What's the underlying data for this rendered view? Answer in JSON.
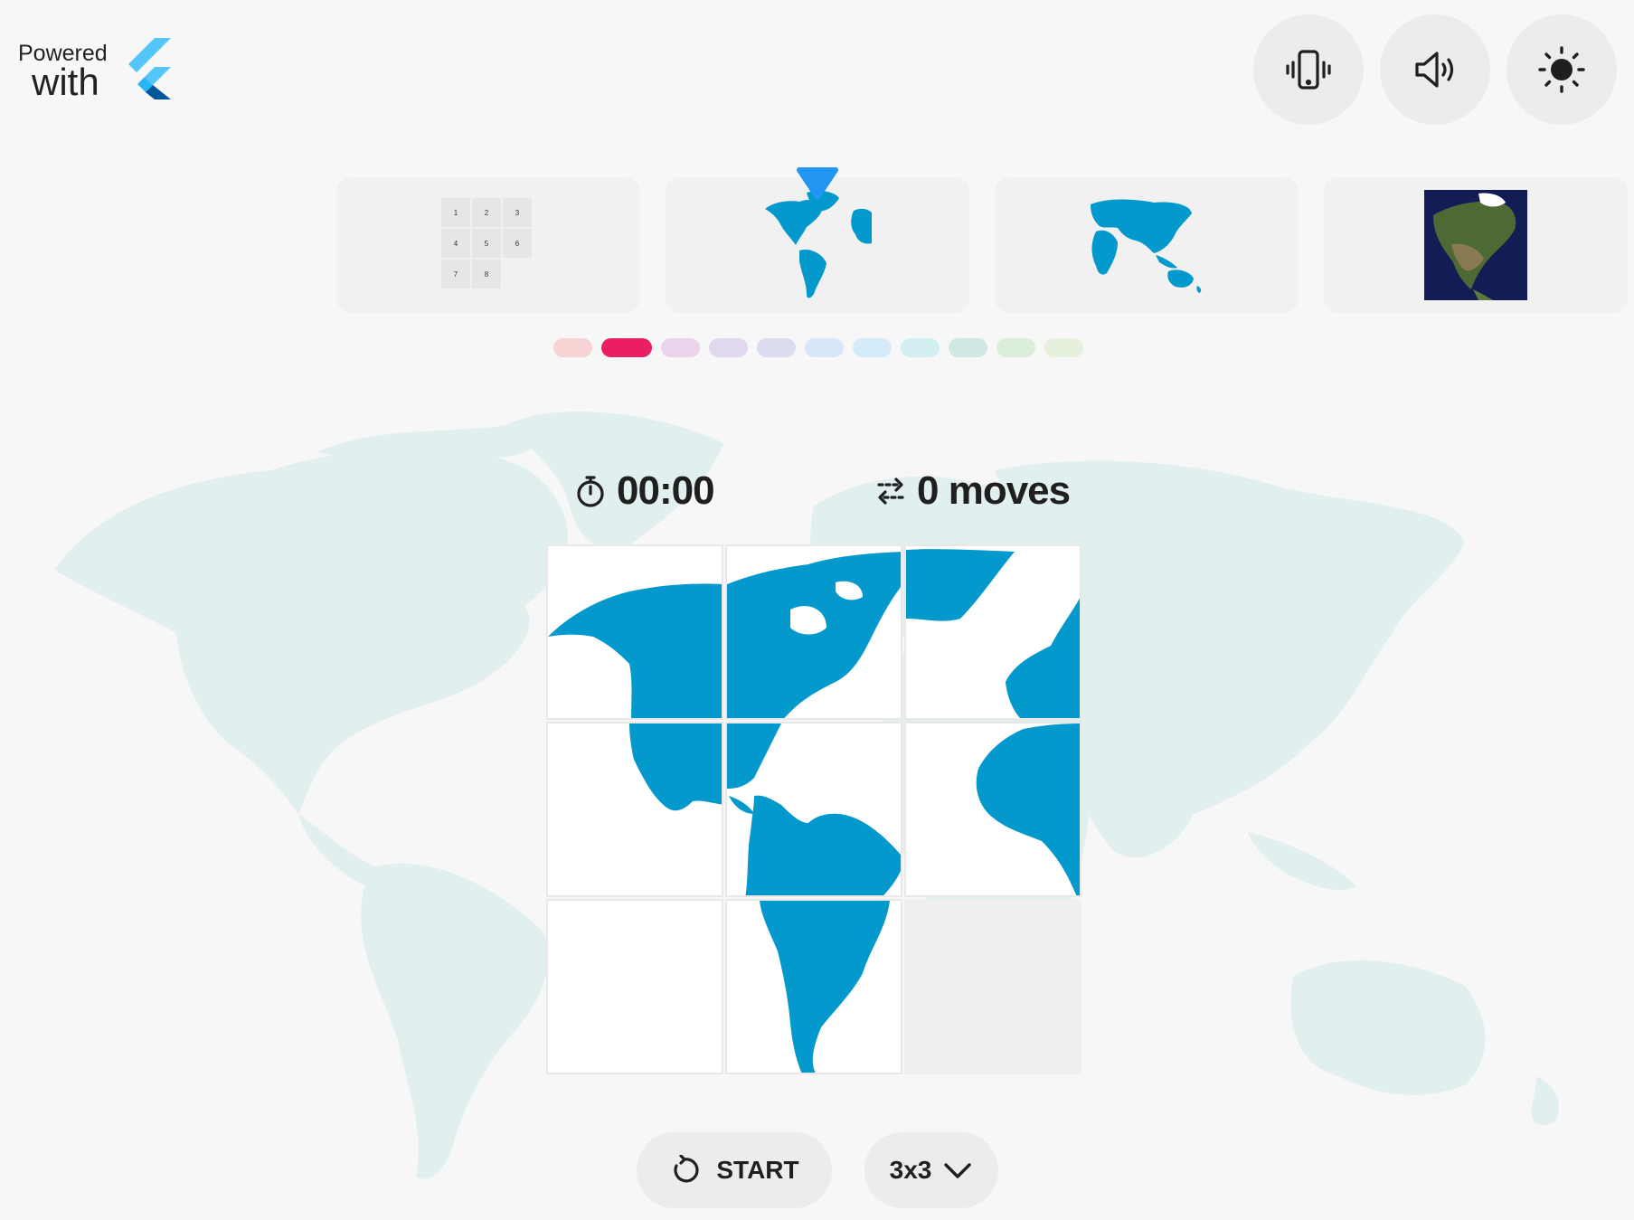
{
  "branding": {
    "powered": "Powered",
    "with": "with"
  },
  "toolbar": {
    "vibration_icon": "phone-vibrate-icon",
    "sound_icon": "speaker-icon",
    "theme_icon": "sun-icon"
  },
  "thumbnails": [
    {
      "name": "number-grid",
      "numbers": [
        "1",
        "2",
        "3",
        "4",
        "5",
        "6",
        "7",
        "8"
      ],
      "selected": false
    },
    {
      "name": "americas-map",
      "selected": true
    },
    {
      "name": "eurasia-map",
      "selected": false
    },
    {
      "name": "north-america-satellite",
      "selected": false
    }
  ],
  "colors": {
    "accent": "#e91e63",
    "map_blue": "#0399cc",
    "bg_map": "#e1efef",
    "dots": [
      "#f8d3d3",
      "#e91e63",
      "#ecd3ec",
      "#e1d8ee",
      "#dbdcf0",
      "#d7e6f8",
      "#d4ecf9",
      "#d4eff2",
      "#cfe8e5",
      "#dbeed9",
      "#e5f1dc"
    ]
  },
  "stats": {
    "time": "00:00",
    "moves": "0 moves"
  },
  "controls": {
    "start_label": "START",
    "size_label": "3x3"
  }
}
